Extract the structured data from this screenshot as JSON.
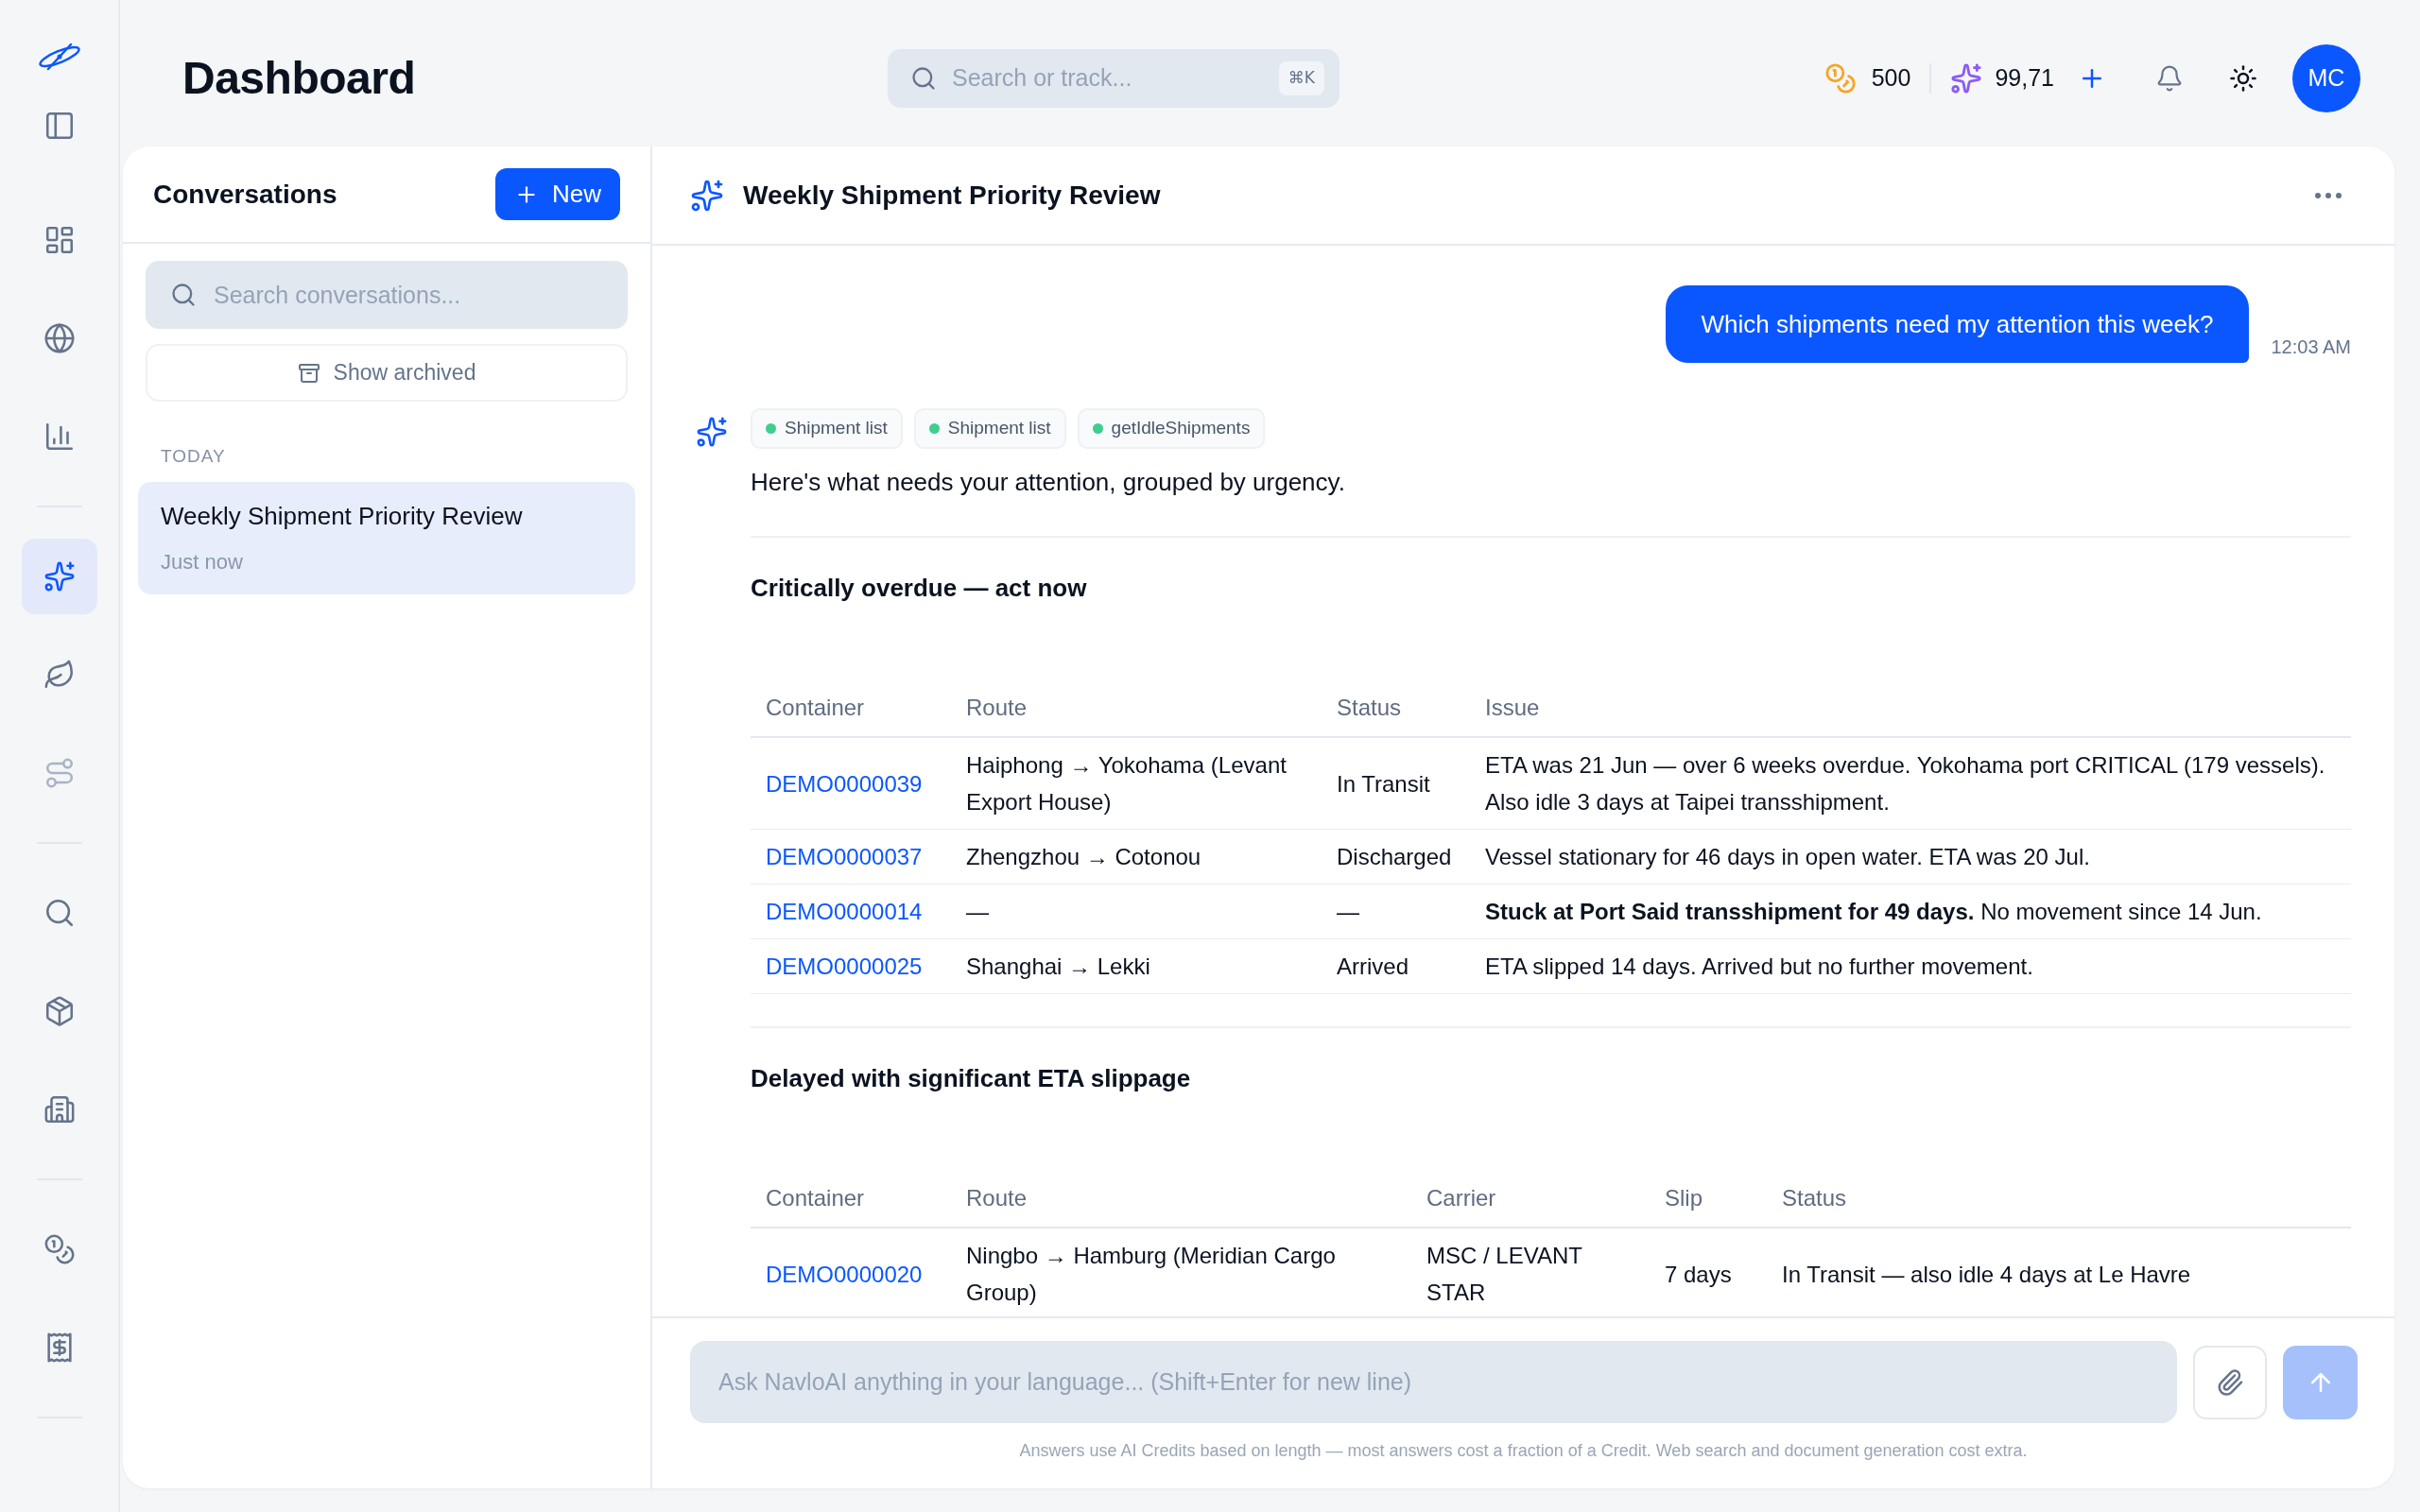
{
  "sidebar": {
    "groups": [
      {
        "items": [
          {
            "selected": false,
            "disabled": false
          },
          {
            "selected": false,
            "disabled": false
          },
          {
            "selected": false,
            "disabled": false
          }
        ]
      },
      {
        "items": [
          {
            "selected": true,
            "disabled": false
          },
          {
            "selected": false,
            "disabled": false
          },
          {
            "selected": false,
            "disabled": true
          }
        ]
      },
      {
        "items": [
          {
            "selected": false,
            "disabled": false
          },
          {
            "selected": false,
            "disabled": false
          },
          {
            "selected": false,
            "disabled": false
          }
        ]
      },
      {
        "items": [
          {
            "selected": false,
            "disabled": false
          },
          {
            "selected": false,
            "disabled": false
          }
        ]
      }
    ]
  },
  "header": {
    "title": "Dashboard",
    "search": {
      "placeholder": "Search or track...",
      "shortcut": "⌘K"
    },
    "credits": "500",
    "ai_credits": "99,71",
    "avatar": "MC"
  },
  "conversations": {
    "title": "Conversations",
    "new_button": "New",
    "search": {
      "placeholder": "Search conversations..."
    },
    "show_archived": "Show archived",
    "groups": [
      {
        "label": "TODAY",
        "items": [
          {
            "title": "Weekly Shipment Priority Review",
            "time": "Just now",
            "selected": true
          }
        ]
      }
    ]
  },
  "chat": {
    "title": "Weekly Shipment Priority Review",
    "messages": [
      {
        "kind": "user",
        "text": "Which shipments need my attention this week?",
        "time": "12:03 AM"
      },
      {
        "kind": "assistant",
        "tools": [
          {
            "label": "Shipment list",
            "color": "#3ecf8e"
          },
          {
            "label": "Shipment list",
            "color": "#3ecf8e"
          },
          {
            "label": "getIdleShipments",
            "color": "#3ecf8e"
          }
        ],
        "blocks": [
          {
            "kind": "paragraph",
            "text": "Here's what needs your attention, grouped by urgency."
          },
          {
            "kind": "divider"
          },
          {
            "kind": "heading",
            "text": "Critically overdue — act now"
          },
          {
            "kind": "table",
            "columns": [
              {
                "label": "Container",
                "kind": "link"
              },
              {
                "label": "Route",
                "kind": "text"
              },
              {
                "label": "Status",
                "kind": "text"
              },
              {
                "label": "Issue",
                "kind": "text"
              }
            ],
            "rows": [
              [
                "DEMO0000039",
                "Haiphong → Yokohama (Levant Export House)",
                "In Transit",
                "ETA was 21 Jun — over 6 weeks overdue. Yokohama port CRITICAL (179 vessels). Also idle 3 days at Taipei transshipment."
              ],
              [
                "DEMO0000037",
                "Zhengzhou → Cotonou",
                "Discharged",
                "Vessel stationary for 46 days in open water. ETA was 20 Jul."
              ],
              [
                "DEMO0000014",
                "—",
                "—",
                "**Stuck at Port Said transshipment for 49 days.** No movement since 14 Jun."
              ],
              [
                "DEMO0000025",
                "Shanghai → Lekki",
                "Arrived",
                "ETA slipped 14 days. Arrived but no further movement."
              ]
            ]
          },
          {
            "kind": "divider"
          },
          {
            "kind": "heading",
            "text": "Delayed with significant ETA slippage"
          },
          {
            "kind": "table",
            "columns": [
              {
                "label": "Container",
                "kind": "link"
              },
              {
                "label": "Route",
                "kind": "text"
              },
              {
                "label": "Carrier",
                "kind": "text"
              },
              {
                "label": "Slip",
                "kind": "text"
              },
              {
                "label": "Status",
                "kind": "text"
              }
            ],
            "rows": [
              [
                "DEMO0000020",
                "Ningbo → Hamburg (Meridian Cargo Group)",
                "MSC / LEVANT STAR",
                "7 days",
                "In Transit — also idle 4 days at Le Havre"
              ]
            ]
          }
        ]
      }
    ]
  },
  "composer": {
    "placeholder": "Ask NavloAI anything in your language... (Shift+Enter for new line)",
    "send_disabled": true,
    "note": "Answers use AI Credits based on length — most answers cost a fraction of a Credit. Web search and document generation cost extra."
  }
}
